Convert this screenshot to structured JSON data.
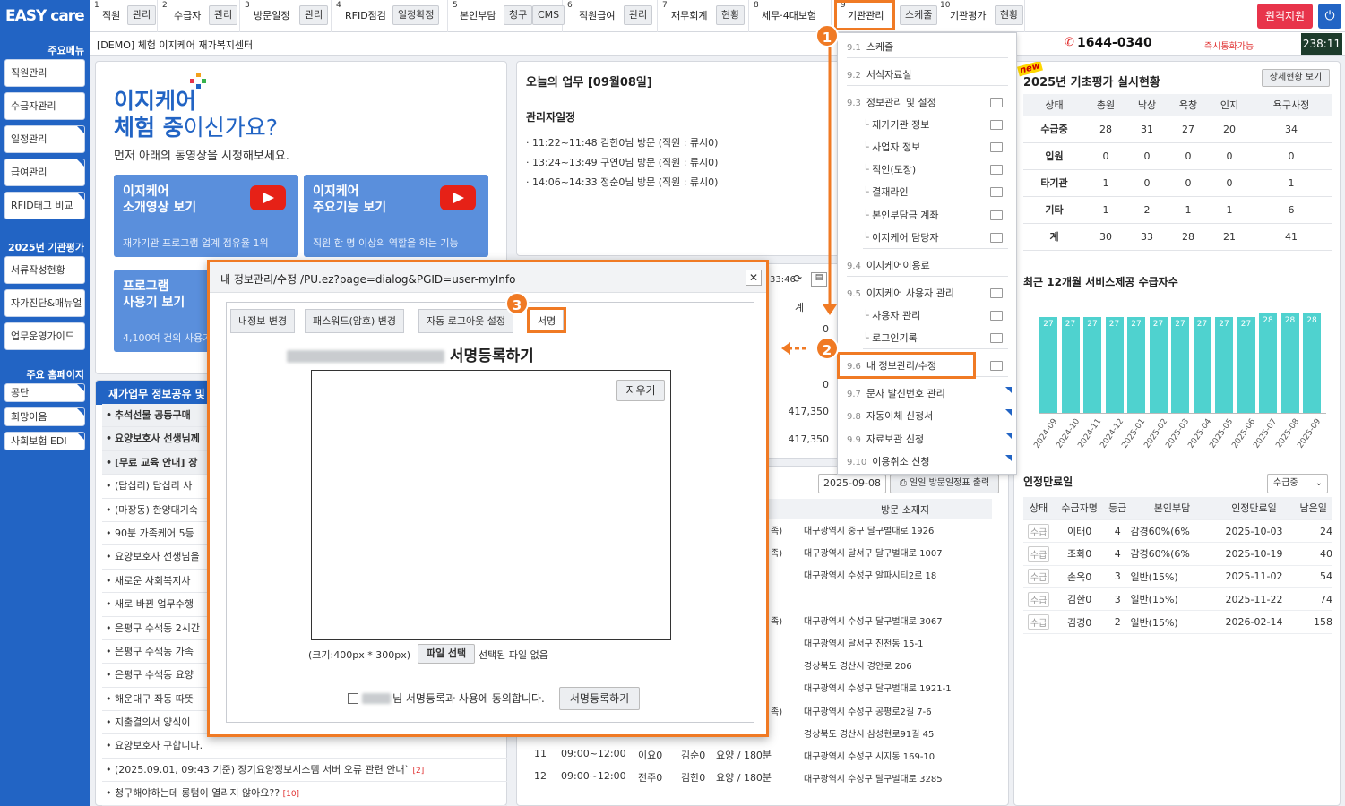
{
  "brand": {
    "logo": "EASY care"
  },
  "menu": [
    {
      "num": "1",
      "label": "직원",
      "btn": "관리"
    },
    {
      "num": "2",
      "label": "수급자",
      "btn": "관리"
    },
    {
      "num": "3",
      "label": "방문일정",
      "btn": "관리"
    },
    {
      "num": "4",
      "label": "RFID점검",
      "btn": "일정확정"
    },
    {
      "num": "5",
      "label": "본인부담",
      "btn": "청구",
      "btn2": "CMS"
    },
    {
      "num": "6",
      "label": "직원급여",
      "btn": "관리"
    },
    {
      "num": "7",
      "label": "재무회계",
      "btn": "현황"
    },
    {
      "num": "8",
      "label": "세무·4대보험"
    },
    {
      "num": "9",
      "label": "기관관리",
      "btn2": "스케줄"
    },
    {
      "num": "10",
      "label": "기관평가",
      "btn": "현황"
    }
  ],
  "top_right": {
    "remote": "원격지원",
    "phone": "1644-0340",
    "phone_note": "즉시통화가능",
    "clock": "238:11"
  },
  "sidebar": {
    "main_title": "주요메뉴",
    "items": [
      "직원관리",
      "수급자관리",
      "일정관리",
      "급여관리",
      "RFID태그 비교"
    ],
    "eval_title": "2025년 기관평가",
    "eval_items": [
      "서류작성현황",
      "자가진단&매뉴얼",
      "업무운영가이드"
    ],
    "home_title": "주요 홈페이지",
    "home_items": [
      "공단",
      "희망이음",
      "사회보험 EDI"
    ]
  },
  "center_name": "[DEMO] 체험 이지케어 재가복지센터",
  "promo": {
    "brand1": "이지케어",
    "brand2a": "체험 중",
    "brand2b": "이신가요?",
    "sub": "먼저 아래의 동영상을 시청해보세요.",
    "cards": [
      {
        "t1": "이지케어",
        "t2": "소개영상 보기",
        "s": "재가기관 프로그램 업계 점유율 1위"
      },
      {
        "t1": "이지케어",
        "t2": "주요기능 보기",
        "s": "직원 한 명 이상의 역할을 하는 기능"
      },
      {
        "t1": "프로그램",
        "t2": "사용기 보기",
        "s": "4,100여 건의 사용기"
      }
    ]
  },
  "notice": {
    "title": "재가업무 정보공유 및",
    "items": [
      "추석선물 공동구매",
      "요양보호사 선생님께",
      "[무료 교육 안내] 장",
      "(답십리) 답십리 사",
      "(마장동) 한양대기숙",
      "90분 가족케어 5등",
      "요양보호사 선생님을",
      "새로운 사회복지사",
      "새로 바뀐 업무수행",
      "은평구 수색동 2시간",
      "은평구 수색동 가족",
      "은평구 수색동 요양",
      "해운대구 좌동 따뜻",
      "지출결의서 양식이",
      "요양보호사 구합니다.",
      "(2025.09.01, 09:43 기준) 장기요양정보시스템 서버 오류 관련 안내`",
      "청구해야하는데 롱텀이 열리지 않아요??"
    ],
    "counts": {
      "15": "[2]",
      "16": "[10]"
    }
  },
  "today": {
    "title": "오늘의 업무 [09월08일]",
    "admin_title": "관리자일정",
    "items": [
      "11:22~11:48 김한0님 방문 (직원 : 류시0)",
      "13:24~13:49 구연0님 방문 (직원 : 류시0)",
      "14:06~14:33 정순0님 방문 (직원 : 류시0)"
    ]
  },
  "mid": {
    "time": "33:46",
    "col": "계",
    "vals": [
      "0",
      "0",
      "417,350",
      "417,350"
    ]
  },
  "schedule": {
    "date": "2025-09-08",
    "print_btn": "일일 방문일정표 출력",
    "col_addr": "방문 소재지",
    "addrs": [
      "대구광역시 중구 달구벌대로 1926",
      "대구광역시 달서구 달구벌대로 1007",
      "대구광역시 수성구 알파시티2로 18",
      "",
      "대구광역시 수성구 달구벌대로 3067",
      "대구광역시 달서구 진천동 15-1",
      "경상북도 경산시 경안로 206",
      "대구광역시 수성구 달구벌대로 1921-1",
      "대구광역시 수성구 공평로2길 7-6",
      "경상북도 경산시 삼성현로91길 45",
      "대구광역시 수성구 시지동 169-10",
      "대구광역시 수성구 달구벌대로 3285"
    ],
    "suffix": "족)",
    "rows": [
      {
        "no": "11",
        "time": "09:00~12:00",
        "c": "이요0",
        "e": "김순0",
        "svc": "요양 / 180분"
      },
      {
        "no": "12",
        "time": "09:00~12:00",
        "c": "전주0",
        "e": "김한0",
        "svc": "요양 / 180분"
      }
    ]
  },
  "eval": {
    "badge": "new",
    "title": "2025년 기초평가 실시현황",
    "detail_btn": "상세현황 보기",
    "headers": [
      "상태",
      "총원",
      "낙상",
      "욕창",
      "인지",
      "욕구사정"
    ],
    "rows": [
      [
        "수급중",
        "28",
        "31",
        "27",
        "20",
        "34"
      ],
      [
        "입원",
        "0",
        "0",
        "0",
        "0",
        "0"
      ],
      [
        "타기관",
        "1",
        "0",
        "0",
        "0",
        "1"
      ],
      [
        "기타",
        "1",
        "2",
        "1",
        "1",
        "6"
      ],
      [
        "계",
        "30",
        "33",
        "28",
        "21",
        "41"
      ]
    ]
  },
  "chart_title": "최근 12개월 서비스제공 수급자수",
  "chart_data": {
    "type": "bar",
    "categories": [
      "2024-09",
      "2024-10",
      "2024-11",
      "2024-12",
      "2025-01",
      "2025-02",
      "2025-03",
      "2025-04",
      "2025-05",
      "2025-06",
      "2025-07",
      "2025-08",
      "2025-09"
    ],
    "values": [
      27,
      27,
      27,
      27,
      27,
      27,
      27,
      27,
      27,
      27,
      28,
      28,
      28
    ],
    "color": "#4fd2cf"
  },
  "cert": {
    "title": "인정만료일",
    "filter": "수급중",
    "headers": [
      "상태",
      "수급자명",
      "등급",
      "본인부담",
      "인정만료일",
      "남은일"
    ],
    "rows": [
      [
        "수급",
        "이태0",
        "4",
        "감경60%(6%",
        "2025-10-03",
        "24"
      ],
      [
        "수급",
        "조화0",
        "4",
        "감경60%(6%",
        "2025-10-19",
        "40"
      ],
      [
        "수급",
        "손옥0",
        "3",
        "일반(15%)",
        "2025-11-02",
        "54"
      ],
      [
        "수급",
        "김한0",
        "3",
        "일반(15%)",
        "2025-11-22",
        "74"
      ],
      [
        "수급",
        "김경0",
        "2",
        "일반(15%)",
        "2026-02-14",
        "158"
      ]
    ]
  },
  "dropdown": [
    {
      "num": "9.1",
      "label": "스케줄"
    },
    {
      "num": "9.2",
      "label": "서식자료실"
    },
    {
      "num": "9.3",
      "label": "정보관리 및 설정"
    },
    {
      "label": "재가기관 정보"
    },
    {
      "label": "사업자 정보"
    },
    {
      "label": "직인(도장)"
    },
    {
      "label": "결재라인"
    },
    {
      "label": "본인부담금 계좌"
    },
    {
      "label": "이지케어 담당자"
    },
    {
      "num": "9.4",
      "label": "이지케어이용료"
    },
    {
      "num": "9.5",
      "label": "이지케어 사용자 관리"
    },
    {
      "label": "사용자 관리"
    },
    {
      "label": "로그인기록"
    },
    {
      "num": "9.6",
      "label": "내 정보관리/수정"
    },
    {
      "num": "9.7",
      "label": "문자 발신번호 관리"
    },
    {
      "num": "9.8",
      "label": "자동이체 신청서"
    },
    {
      "num": "9.9",
      "label": "자료보관 신청"
    },
    {
      "num": "9.10",
      "label": "이용취소 신청"
    }
  ],
  "dialog": {
    "title": "내 정보관리/수정 /PU.ez?page=dialog&PGID=user-myInfo",
    "tabs": [
      "내정보 변경",
      "패스워드(암호) 변경",
      "자동 로그아웃 설정",
      "서명"
    ],
    "heading": "서명등록하기",
    "clear": "지우기",
    "size_note": "(크기:400px * 300px)",
    "file_btn": "파일 선택",
    "file_none": "선택된 파일 없음",
    "agree": "님 서명등록과 사용에 동의합니다.",
    "submit": "서명등록하기"
  },
  "callouts": [
    "1",
    "2",
    "3"
  ]
}
